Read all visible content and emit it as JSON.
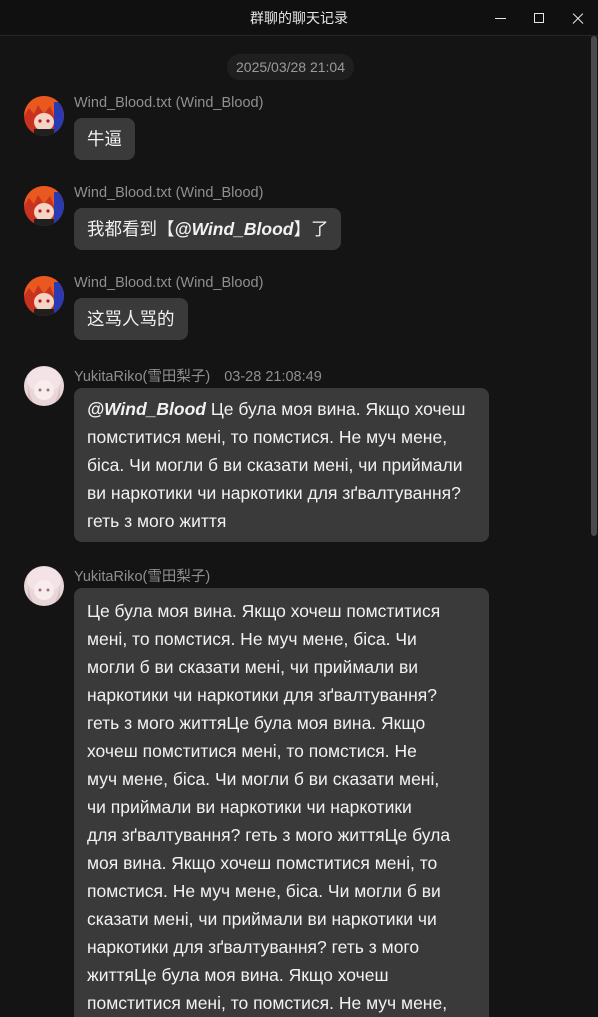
{
  "window": {
    "title": "群聊的聊天记录"
  },
  "chat": {
    "time_divider": "2025/03/28 21:04",
    "messages": [
      {
        "sender": "Wind_Blood.txt",
        "sender_id": "(Wind_Blood)",
        "time": "",
        "avatar": "orange-hair-character-avatar",
        "text_before": "牛逼",
        "mention": "",
        "text_after": ""
      },
      {
        "sender": "Wind_Blood.txt",
        "sender_id": "(Wind_Blood)",
        "time": "",
        "avatar": "orange-hair-character-avatar",
        "text_before": "我都看到【",
        "mention": "@Wind_Blood",
        "text_after": "】了"
      },
      {
        "sender": "Wind_Blood.txt",
        "sender_id": "(Wind_Blood)",
        "time": "",
        "avatar": "orange-hair-character-avatar",
        "text_before": "这骂人骂的",
        "mention": "",
        "text_after": ""
      },
      {
        "sender": "YukitaRiko",
        "sender_id": "(雪田梨子)",
        "time": "03-28 21:08:49",
        "avatar": "pink-hair-character-avatar",
        "text_before": "",
        "mention": "@Wind_Blood",
        "text_after": " Це була моя вина. Якщо хочеш помститися мені, то помстися. Не муч мене, біса. Чи могли б ви сказати мені, чи приймали ви наркотики чи наркотики для зґвалтування? геть з мого життя"
      },
      {
        "sender": "YukitaRiko",
        "sender_id": "(雪田梨子)",
        "time": "",
        "avatar": "pink-hair-character-avatar",
        "lines": [
          "Це була моя вина. Якщо хочеш помститися",
          "мені, то помстися. Не муч мене, біса. Чи",
          "могли б ви сказати мені, чи приймали ви",
          "наркотики чи наркотики для зґвалтування?",
          "геть з мого життяЦе була моя вина. Якщо",
          "хочеш помститися мені, то помстися. Не",
          "муч мене, біса. Чи могли б ви сказати мені,",
          "чи приймали ви наркотики чи наркотики",
          "для зґвалтування? геть з мого життяЦе була",
          "моя вина. Якщо хочеш помститися мені, то",
          "помстися. Не муч мене, біса. Чи могли б ви",
          "сказати мені, чи приймали ви наркотики чи",
          "наркотики для зґвалтування? геть з мого",
          "життяЦе була моя вина. Якщо хочеш",
          "помститися мені, то помстися. Не муч мене,"
        ]
      }
    ]
  },
  "colors": {
    "background": "#141414",
    "bubble": "#3a3a3a",
    "meta_text": "#8f8f8f",
    "message_text": "#f2f2f2"
  }
}
